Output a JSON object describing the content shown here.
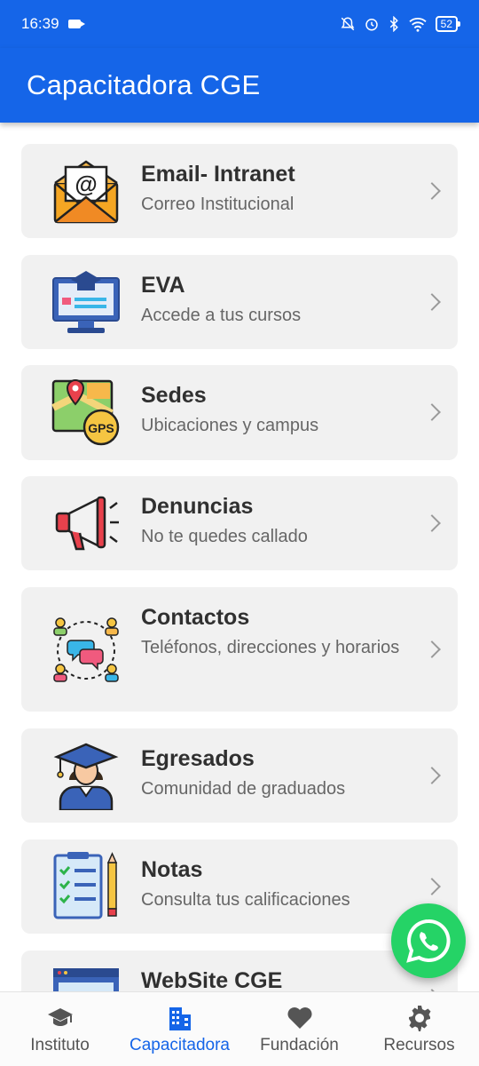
{
  "status_bar": {
    "time": "16:39",
    "battery": "52"
  },
  "app_bar": {
    "title": "Capacitadora CGE"
  },
  "items": [
    {
      "title": "Email- Intranet",
      "subtitle": "Correo Institucional",
      "icon": "email-envelope-icon"
    },
    {
      "title": "EVA",
      "subtitle": "Accede a tus cursos",
      "icon": "monitor-graduation-cap-icon"
    },
    {
      "title": "Sedes",
      "subtitle": "Ubicaciones y campus",
      "icon": "map-gps-icon",
      "badge": "GPS"
    },
    {
      "title": "Denuncias",
      "subtitle": "No te quedes callado",
      "icon": "megaphone-icon"
    },
    {
      "title": "Contactos",
      "subtitle": "Teléfonos, direcciones y horarios",
      "icon": "contacts-group-icon"
    },
    {
      "title": "Egresados",
      "subtitle": "Comunidad de graduados",
      "icon": "graduate-icon"
    },
    {
      "title": "Notas",
      "subtitle": "Consulta tus calificaciones",
      "icon": "checklist-icon"
    },
    {
      "title": "WebSite CGE",
      "subtitle": "",
      "icon": "website-icon"
    }
  ],
  "bottom_nav": [
    {
      "label": "Instituto",
      "icon": "graduation-cap-icon",
      "active": false
    },
    {
      "label": "Capacitadora",
      "icon": "building-icon",
      "active": true
    },
    {
      "label": "Fundación",
      "icon": "heart-icon",
      "active": false
    },
    {
      "label": "Recursos",
      "icon": "gear-icon",
      "active": false
    }
  ],
  "colors": {
    "primary": "#1565e8",
    "card_bg": "#f1f1f1",
    "whatsapp": "#25d366"
  }
}
